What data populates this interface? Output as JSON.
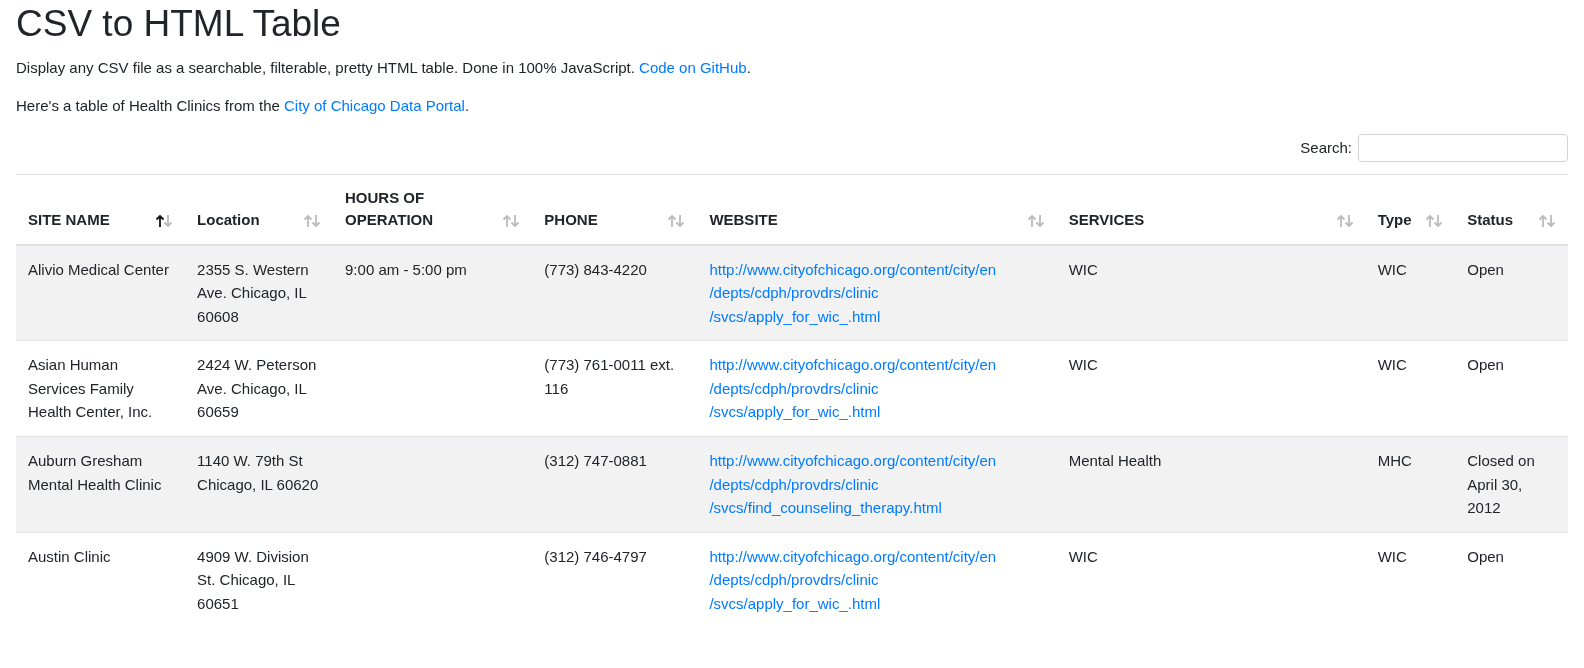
{
  "title": "CSV to HTML Table",
  "intro": {
    "text": "Display any CSV file as a searchable, filterable, pretty HTML table. Done in 100% JavaScript.",
    "link": "Code on GitHub",
    "after": "."
  },
  "source": {
    "text": "Here's a table of Health Clinics from the",
    "link": "City of Chicago Data Portal",
    "after": "."
  },
  "search": {
    "label": "Search:"
  },
  "table": {
    "columns": [
      {
        "label": "SITE NAME",
        "sorted_ascending": true
      },
      {
        "label": "Location",
        "sorted_ascending": false
      },
      {
        "label": "HOURS OF OPERATION",
        "sorted_ascending": false
      },
      {
        "label": "PHONE",
        "sorted_ascending": false
      },
      {
        "label": "WEBSITE",
        "sorted_ascending": false
      },
      {
        "label": "SERVICES",
        "sorted_ascending": false
      },
      {
        "label": "Type",
        "sorted_ascending": false
      },
      {
        "label": "Status",
        "sorted_ascending": false
      }
    ],
    "rows": [
      [
        "Alivio Medical Center",
        "2355 S. Western Ave. Chicago, IL 60608",
        "9:00 am - 5:00 pm",
        "(773) 843-4220",
        "http://www.cityofchicago.org/content/city/en/depts/cdph/provdrs/clinic/svcs/apply_for_wic_.html",
        "WIC",
        "WIC",
        "Open"
      ],
      [
        "Asian Human Services Family Health Center, Inc.",
        "2424 W. Peterson Ave. Chicago, IL 60659",
        "",
        "(773) 761-0011 ext. 116",
        "http://www.cityofchicago.org/content/city/en/depts/cdph/provdrs/clinic/svcs/apply_for_wic_.html",
        "WIC",
        "WIC",
        "Open"
      ],
      [
        "Auburn Gresham Mental Health Clinic",
        "1140 W. 79th St Chicago, IL 60620",
        "",
        "(312) 747-0881",
        "http://www.cityofchicago.org/content/city/en/depts/cdph/provdrs/clinic/svcs/find_counseling_therapy.html",
        "Mental Health",
        "MHC",
        "Closed on April 30, 2012"
      ],
      [
        "Austin Clinic",
        "4909 W. Division St. Chicago, IL 60651",
        "",
        "(312) 746-4797",
        "http://www.cityofchicago.org/content/city/en/depts/cdph/provdrs/clinic/svcs/apply_for_wic_.html",
        "WIC",
        "WIC",
        "Open"
      ]
    ]
  }
}
